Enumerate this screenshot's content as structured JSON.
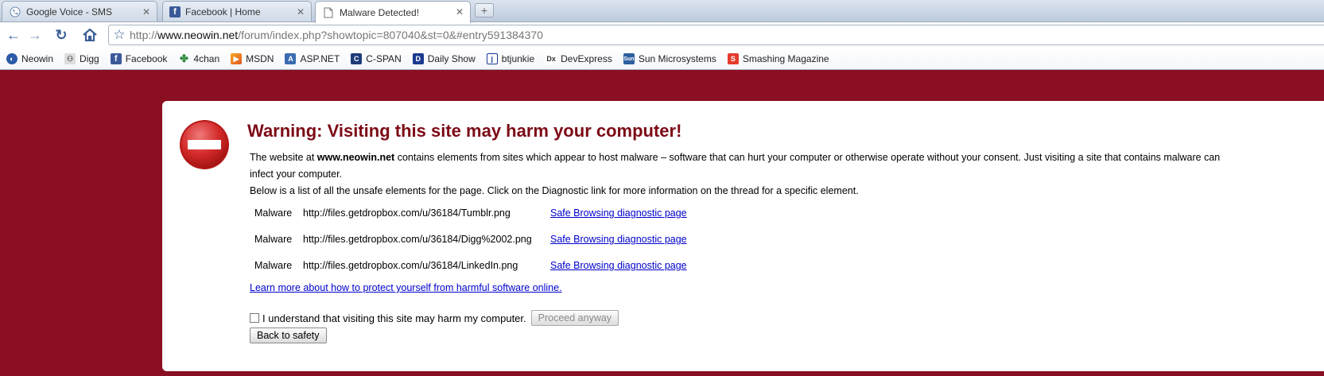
{
  "tabs": [
    {
      "title": "Google Voice - SMS",
      "icon": "phone-icon"
    },
    {
      "title": "Facebook | Home",
      "icon": "facebook-icon"
    },
    {
      "title": "Malware Detected!",
      "icon": "page-icon",
      "active": true
    }
  ],
  "address_bar": {
    "scheme": "http://",
    "host": "www.neowin.net",
    "path": "/forum/index.php?showtopic=807040&st=0&#entry591384370"
  },
  "bookmarks": [
    {
      "label": "Neowin",
      "icon": "neowin-icon"
    },
    {
      "label": "Digg",
      "icon": "digg-icon"
    },
    {
      "label": "Facebook",
      "icon": "facebook-icon"
    },
    {
      "label": "4chan",
      "icon": "clover-icon"
    },
    {
      "label": "MSDN",
      "icon": "msdn-icon"
    },
    {
      "label": "ASP.NET",
      "icon": "aspnet-icon"
    },
    {
      "label": "C-SPAN",
      "icon": "cspan-icon"
    },
    {
      "label": "Daily Show",
      "icon": "dailyshow-icon"
    },
    {
      "label": "btjunkie",
      "icon": "btjunkie-icon"
    },
    {
      "label": "DevExpress",
      "icon": "devexpress-icon"
    },
    {
      "label": "Sun Microsystems",
      "icon": "sun-icon"
    },
    {
      "label": "Smashing Magazine",
      "icon": "smashing-icon"
    }
  ],
  "warning": {
    "title": "Warning: Visiting this site may harm your computer!",
    "intro_prefix": "The website at ",
    "intro_site": "www.neowin.net",
    "intro_suffix": " contains elements from sites which appear to host malware – software that can hurt your computer or otherwise operate without your consent. Just visiting a site that contains malware can",
    "intro_line2": "infect your computer.",
    "list_intro": "Below is a list of all the unsafe elements for the page. Click on the Diagnostic link for more information on the thread for a specific element.",
    "elements": [
      {
        "type": "Malware",
        "url": "http://files.getdropbox.com/u/36184/Tumblr.png",
        "link": "Safe Browsing diagnostic page"
      },
      {
        "type": "Malware",
        "url": "http://files.getdropbox.com/u/36184/Digg%2002.png",
        "link": "Safe Browsing diagnostic page"
      },
      {
        "type": "Malware",
        "url": "http://files.getdropbox.com/u/36184/LinkedIn.png",
        "link": "Safe Browsing diagnostic page"
      }
    ],
    "learn_more": "Learn more about how to protect yourself from harmful software online.",
    "consent_label": "I understand that visiting this site may harm my computer.",
    "proceed_button": "Proceed anyway",
    "back_button": "Back to safety"
  },
  "colors": {
    "page_background": "#8b0f22",
    "title": "#7c0a16",
    "link": "#0000cc"
  }
}
